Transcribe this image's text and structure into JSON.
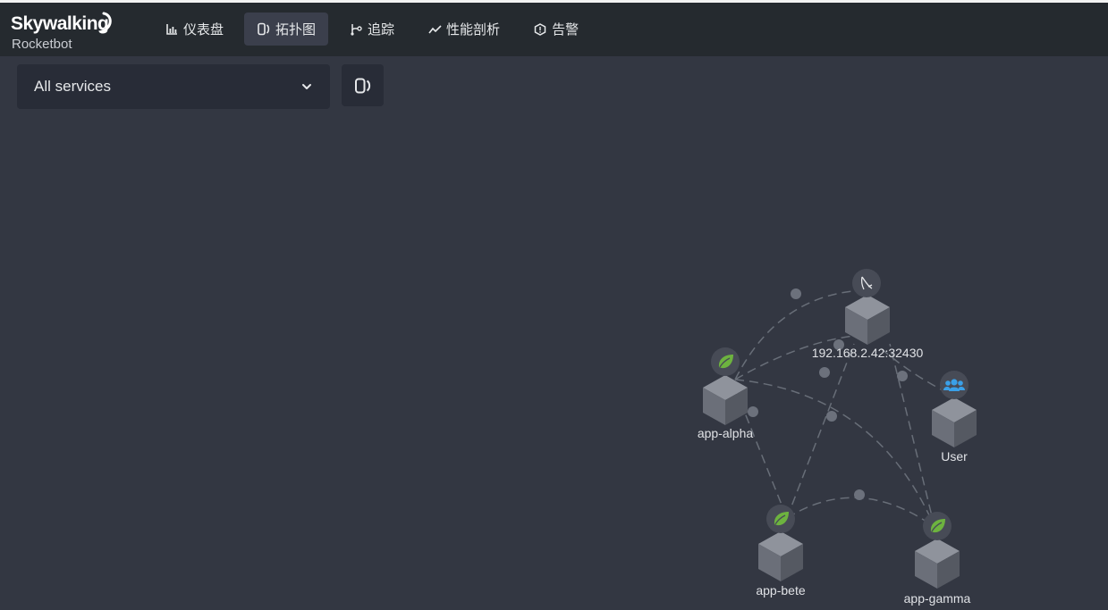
{
  "app": {
    "logo_main": "Skywalking",
    "logo_sub": "Rocketbot"
  },
  "nav": {
    "items": [
      {
        "label": "仪表盘",
        "icon": "bar-chart-icon",
        "active": false
      },
      {
        "label": "拓扑图",
        "icon": "topology-icon",
        "active": true
      },
      {
        "label": "追踪",
        "icon": "trace-branch-icon",
        "active": false
      },
      {
        "label": "性能剖析",
        "icon": "trend-line-icon",
        "active": false
      },
      {
        "label": "告警",
        "icon": "alert-icon",
        "active": false
      }
    ]
  },
  "toolbar": {
    "service_select_value": "All services",
    "topology_button_icon": "topology-icon"
  },
  "topology": {
    "nodes": [
      {
        "id": "mysql",
        "label": "192.168.2.42:32430",
        "icon": "mysql-dolphin-icon"
      },
      {
        "id": "alpha",
        "label": "app-alpha",
        "icon": "spring-leaf-icon"
      },
      {
        "id": "user",
        "label": "User",
        "icon": "users-icon"
      },
      {
        "id": "bete",
        "label": "app-bete",
        "icon": "spring-leaf-icon"
      },
      {
        "id": "gamma",
        "label": "app-gamma",
        "icon": "spring-leaf-icon"
      }
    ],
    "edges": [
      {
        "from": "alpha",
        "to": "mysql"
      },
      {
        "from": "alpha",
        "to": "mysql"
      },
      {
        "from": "user",
        "to": "mysql"
      },
      {
        "from": "alpha",
        "to": "bete"
      },
      {
        "from": "alpha",
        "to": "gamma"
      },
      {
        "from": "bete",
        "to": "mysql"
      },
      {
        "from": "bete",
        "to": "gamma"
      },
      {
        "from": "gamma",
        "to": "mysql"
      }
    ],
    "colors": {
      "edge": "#686e78",
      "edge_dot": "#6c717c",
      "cube_top": "#8f939c",
      "cube_left": "#6b6f79",
      "cube_right": "#555962",
      "icon_bg": "#474b56",
      "spring": "#6db33f",
      "users": "#3aa0e8"
    }
  }
}
